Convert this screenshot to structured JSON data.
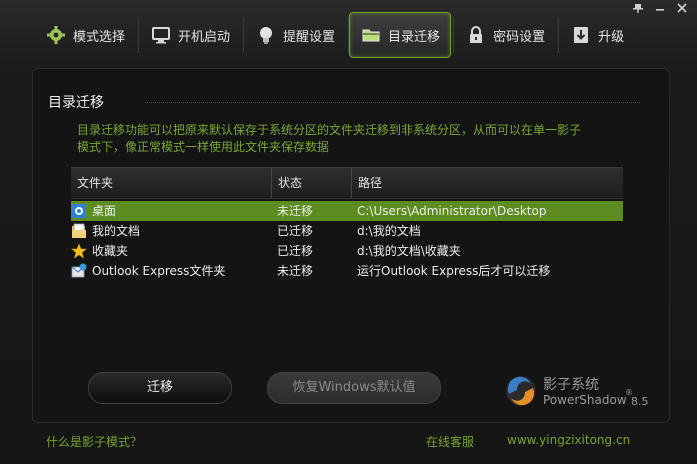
{
  "window": {
    "controls": [
      "pin-icon",
      "minimize-icon",
      "close-icon"
    ]
  },
  "nav": [
    {
      "label": "模式选择",
      "icon": "gear-icon"
    },
    {
      "label": "开机启动",
      "icon": "monitor-icon"
    },
    {
      "label": "提醒设置",
      "icon": "lightbulb-icon"
    },
    {
      "label": "目录迁移",
      "icon": "folder-icon",
      "active": true
    },
    {
      "label": "密码设置",
      "icon": "lock-icon"
    },
    {
      "label": "升级",
      "icon": "download-icon"
    }
  ],
  "panel": {
    "title": "目录迁移",
    "description_line1": "目录迁移功能可以把原来默认保存于系统分区的文件夹迁移到非系统分区，从而可以在单一影子",
    "description_line2": "模式下，像正常模式一样使用此文件夹保存数据"
  },
  "table": {
    "headers": [
      "文件夹",
      "状态",
      "路径"
    ],
    "rows": [
      {
        "name": "桌面",
        "status": "未迁移",
        "path": "C:\\Users\\Administrator\\Desktop",
        "icon": "desktop-icon",
        "selected": true
      },
      {
        "name": "我的文档",
        "status": "已迁移",
        "path": "d:\\我的文档",
        "icon": "documents-icon"
      },
      {
        "name": "收藏夹",
        "status": "已迁移",
        "path": "d:\\我的文档\\收藏夹",
        "icon": "star-icon"
      },
      {
        "name": "Outlook Express文件夹",
        "status": "未迁移",
        "path": "运行Outlook Express后才可以迁移",
        "icon": "outlook-icon"
      }
    ]
  },
  "buttons": {
    "migrate": "迁移",
    "restore": "恢复Windows默认值"
  },
  "logo": {
    "name_cn": "影子系统",
    "name_en": "PowerShadow",
    "registered": "®",
    "version": "8.5"
  },
  "footer": {
    "what_is": "什么是影子模式？",
    "support": "在线客服",
    "website": "www.yingzixitong.cn"
  },
  "colors": {
    "accent": "#6fa32a",
    "selected_row": "#5d8d21",
    "description_text": "#78a832"
  }
}
